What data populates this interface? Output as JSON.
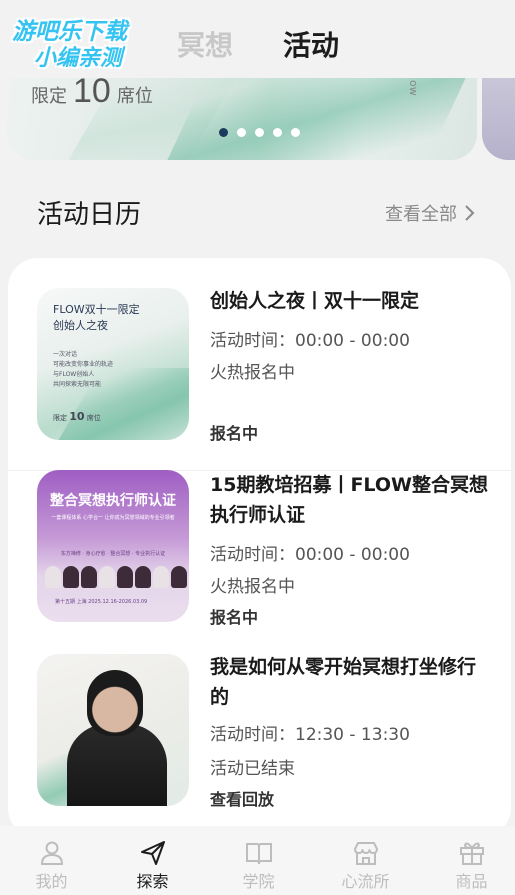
{
  "watermark": {
    "line1": "游吧乐下载",
    "line2": "小编亲测"
  },
  "tabs": [
    {
      "label": "冥想",
      "active": false
    },
    {
      "label": "活动",
      "active": true
    }
  ],
  "banner": {
    "limit_prefix": "限定",
    "limit_number": "10",
    "limit_suffix": "席位",
    "side_text": "ow",
    "dots_total": 5,
    "active_dot": 0
  },
  "section": {
    "title": "活动日历",
    "see_all": "查看全部"
  },
  "events": [
    {
      "title": "创始人之夜丨双十一限定",
      "time": "活动时间：00:00 - 00:00",
      "status": "火热报名中",
      "action": "报名中",
      "thumb": {
        "title_line1": "FLOW双十一限定",
        "title_line2": "创始人之夜",
        "sub_line1": "一次对话",
        "sub_line2": "可能改变你事业的轨迹",
        "sub_line3": "与FLOW创始人",
        "sub_line4": "共同探索无限可能",
        "bottom_prefix": "限定",
        "bottom_number": "10",
        "bottom_suffix": "席位"
      }
    },
    {
      "title": "15期教培招募丨FLOW整合冥想执行师认证",
      "time": "活动时间：00:00 - 00:00",
      "status": "火热报名中",
      "action": "报名中",
      "thumb": {
        "title": "整合冥想执行师认证",
        "subtitle": "一套课程体系 心学合一 让你成为冥想领域的专业引领者",
        "line": "东方禅修 · 身心疗愈 · 整合冥想 · 专业执行认证",
        "foot": "第十五期 上海 2025.12.16-2026.03.09"
      }
    },
    {
      "title": "我是如何从零开始冥想打坐修行的",
      "time": "活动时间：12:30 - 13:30",
      "status": "活动已结束",
      "action": "查看回放"
    }
  ],
  "bottom_nav": [
    {
      "label": "我的",
      "icon": "person-icon",
      "active": false
    },
    {
      "label": "探索",
      "icon": "paper-plane-icon",
      "active": true
    },
    {
      "label": "学院",
      "icon": "book-icon",
      "active": false
    },
    {
      "label": "心流所",
      "icon": "storefront-icon",
      "active": false
    },
    {
      "label": "商品",
      "icon": "gift-icon",
      "active": false
    }
  ],
  "colors": {
    "background": "#f2f2f2",
    "active_tab": "#1c1c1c",
    "inactive_tab": "#c8c8c8",
    "active_dot": "#1c3a5c",
    "nav_inactive": "#bdbdbd"
  }
}
